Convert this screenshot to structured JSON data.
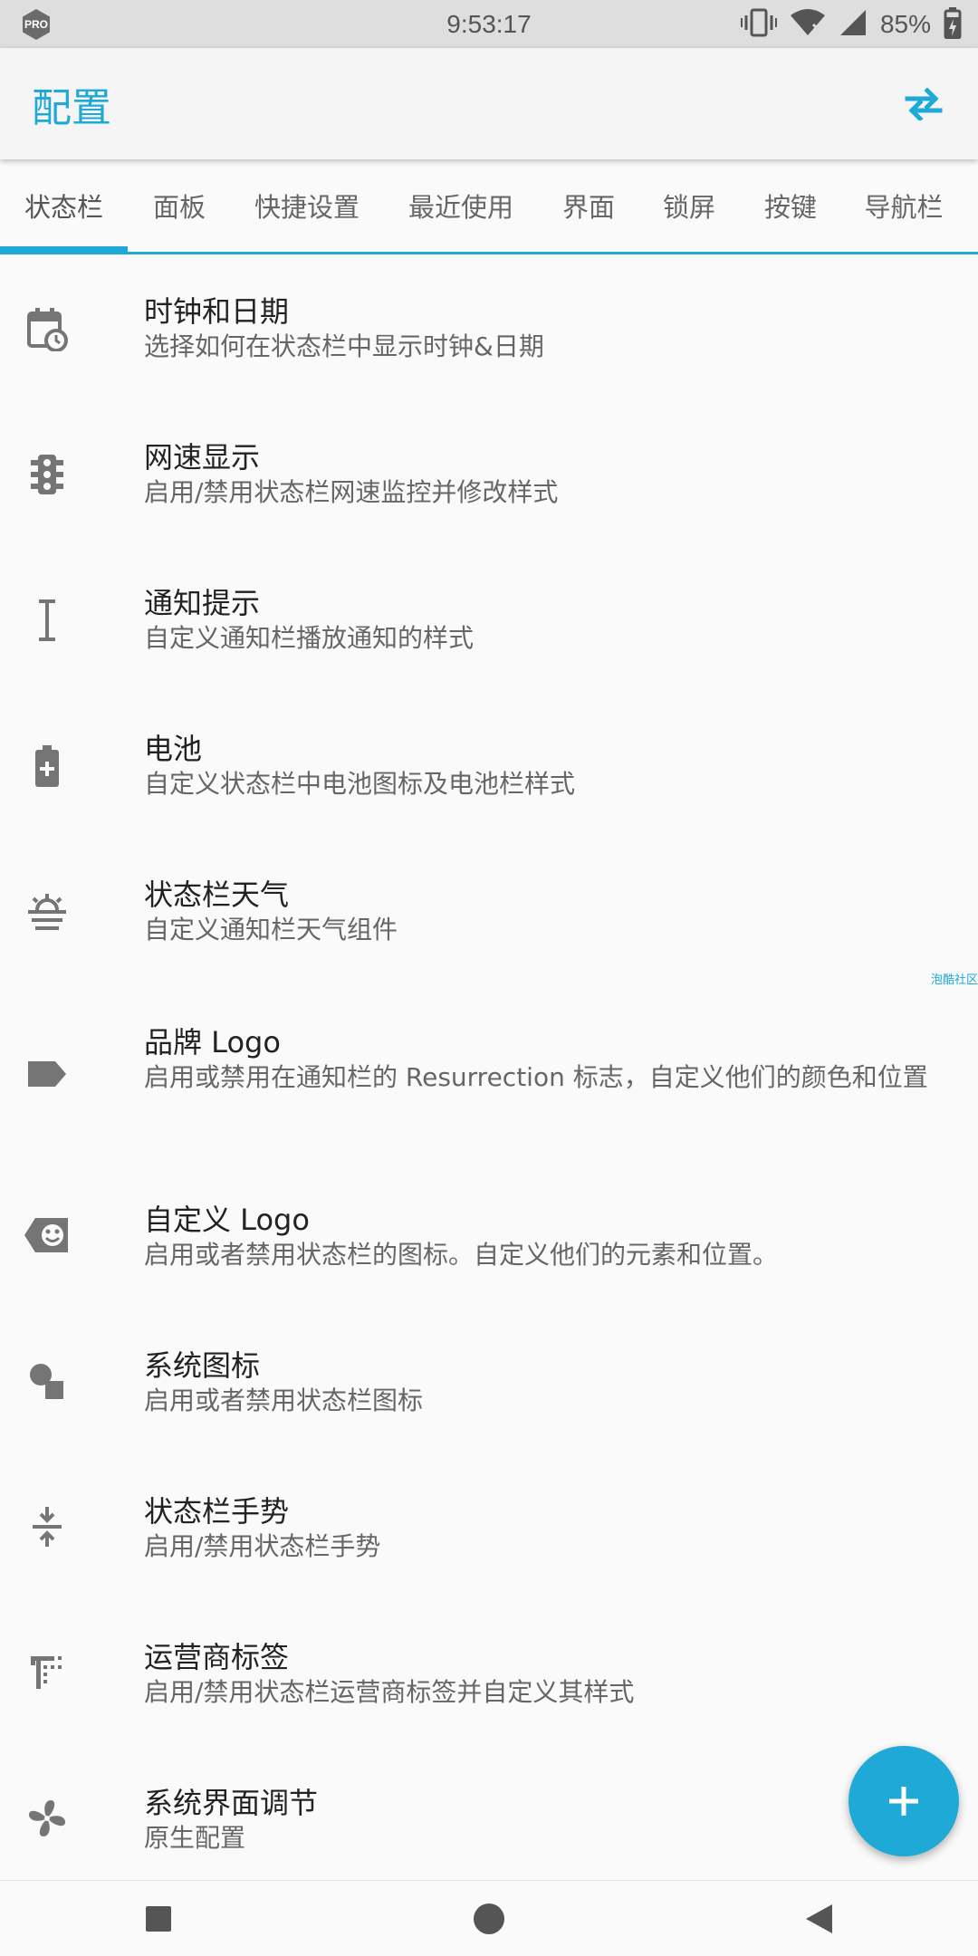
{
  "status_bar": {
    "badge": "PRO",
    "time": "9:53:17",
    "battery": "85%",
    "icons": [
      "vibrate-icon",
      "wifi-icon",
      "signal-icon",
      "battery-charging-icon"
    ]
  },
  "app_bar": {
    "title": "配置",
    "action_icon": "swap-icon"
  },
  "tabs": [
    {
      "label": "状态栏",
      "active": true
    },
    {
      "label": "面板",
      "active": false
    },
    {
      "label": "快捷设置",
      "active": false
    },
    {
      "label": "最近使用",
      "active": false
    },
    {
      "label": "界面",
      "active": false
    },
    {
      "label": "锁屏",
      "active": false
    },
    {
      "label": "按键",
      "active": false
    },
    {
      "label": "导航栏",
      "active": false
    }
  ],
  "items": [
    {
      "title": "时钟和日期",
      "subtitle": "选择如何在状态栏中显示时钟&日期",
      "icon": "calendar-clock-icon"
    },
    {
      "title": "网速显示",
      "subtitle": "启用/禁用状态栏网速监控并修改样式",
      "icon": "traffic-light-icon"
    },
    {
      "title": "通知提示",
      "subtitle": "自定义通知栏播放通知的样式",
      "icon": "text-cursor-icon"
    },
    {
      "title": "电池",
      "subtitle": "自定义状态栏中电池图标及电池栏样式",
      "icon": "battery-plus-icon"
    },
    {
      "title": "状态栏天气",
      "subtitle": "自定义通知栏天气组件",
      "icon": "weather-haze-icon"
    },
    {
      "title": "品牌 Logo",
      "subtitle": "启用或禁用在通知栏的 Resurrection 标志，自定义他们的颜色和位置",
      "icon": "label-icon"
    },
    {
      "title": "自定义 Logo",
      "subtitle": "启用或者禁用状态栏的图标。自定义他们的元素和位置。",
      "icon": "smiley-tag-icon"
    },
    {
      "title": "系统图标",
      "subtitle": "启用或者禁用状态栏图标",
      "icon": "shapes-icon"
    },
    {
      "title": "状态栏手势",
      "subtitle": "启用/禁用状态栏手势",
      "icon": "vertical-gesture-icon"
    },
    {
      "title": "运营商标签",
      "subtitle": "启用/禁用状态栏运营商标签并自定义其样式",
      "icon": "text-label-icon"
    },
    {
      "title": "系统界面调节",
      "subtitle": "原生配置",
      "icon": "fan-icon"
    }
  ],
  "watermark": "泡酷社区",
  "fab": {
    "icon": "plus-icon"
  },
  "nav": {
    "icons": [
      "recents-square-icon",
      "home-circle-icon",
      "back-triangle-icon"
    ]
  },
  "colors": {
    "accent": "#1ea9d6",
    "icon_gray": "#757575"
  }
}
